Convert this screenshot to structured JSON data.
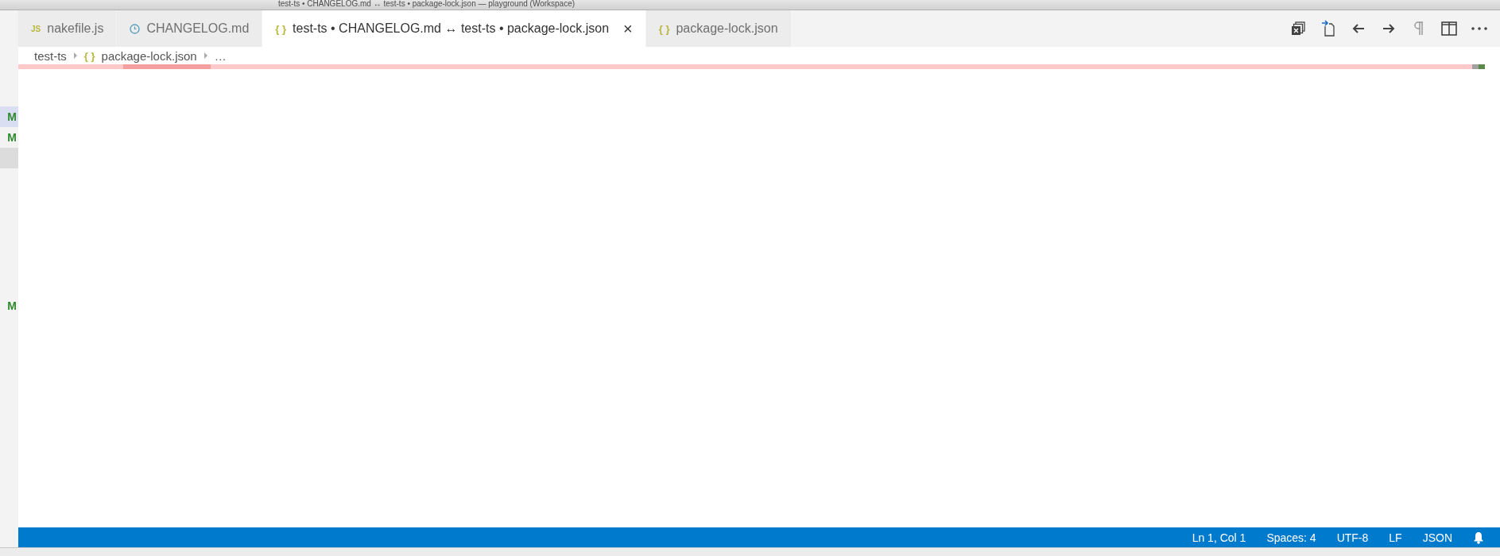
{
  "window": {
    "title": "test-ts • CHANGELOG.md ↔ test-ts • package-lock.json — playground (Workspace)"
  },
  "tabs": [
    {
      "label": "nakefile.js",
      "icon": "JS",
      "kind": "js",
      "selected": false
    },
    {
      "label": "CHANGELOG.md",
      "kind": "md",
      "selected": false
    },
    {
      "label": "test-ts • CHANGELOG.md ↔ test-ts • package-lock.json",
      "icon": "{ }",
      "kind": "json",
      "selected": true,
      "close": "×"
    },
    {
      "label": "package-lock.json",
      "icon": "{ }",
      "kind": "json",
      "selected": false
    }
  ],
  "breadcrumbs": [
    {
      "label": "test-ts"
    },
    {
      "label": "package-lock.json",
      "icon": "{ }"
    },
    {
      "label": "…"
    }
  ],
  "sidebar": {
    "items": [
      {
        "kind": "file",
        "label": "M",
        "selected": true
      },
      {
        "kind": "file",
        "label": "M",
        "selected": false
      },
      {
        "kind": "blank",
        "selected": false
      },
      {
        "kind": "file",
        "label": "M",
        "selected": false
      }
    ]
  },
  "status_bar": {
    "items": [
      "Ln 1, Col 1",
      "Spaces: 4",
      "UTF-8",
      "LF",
      "JSON"
    ]
  }
}
